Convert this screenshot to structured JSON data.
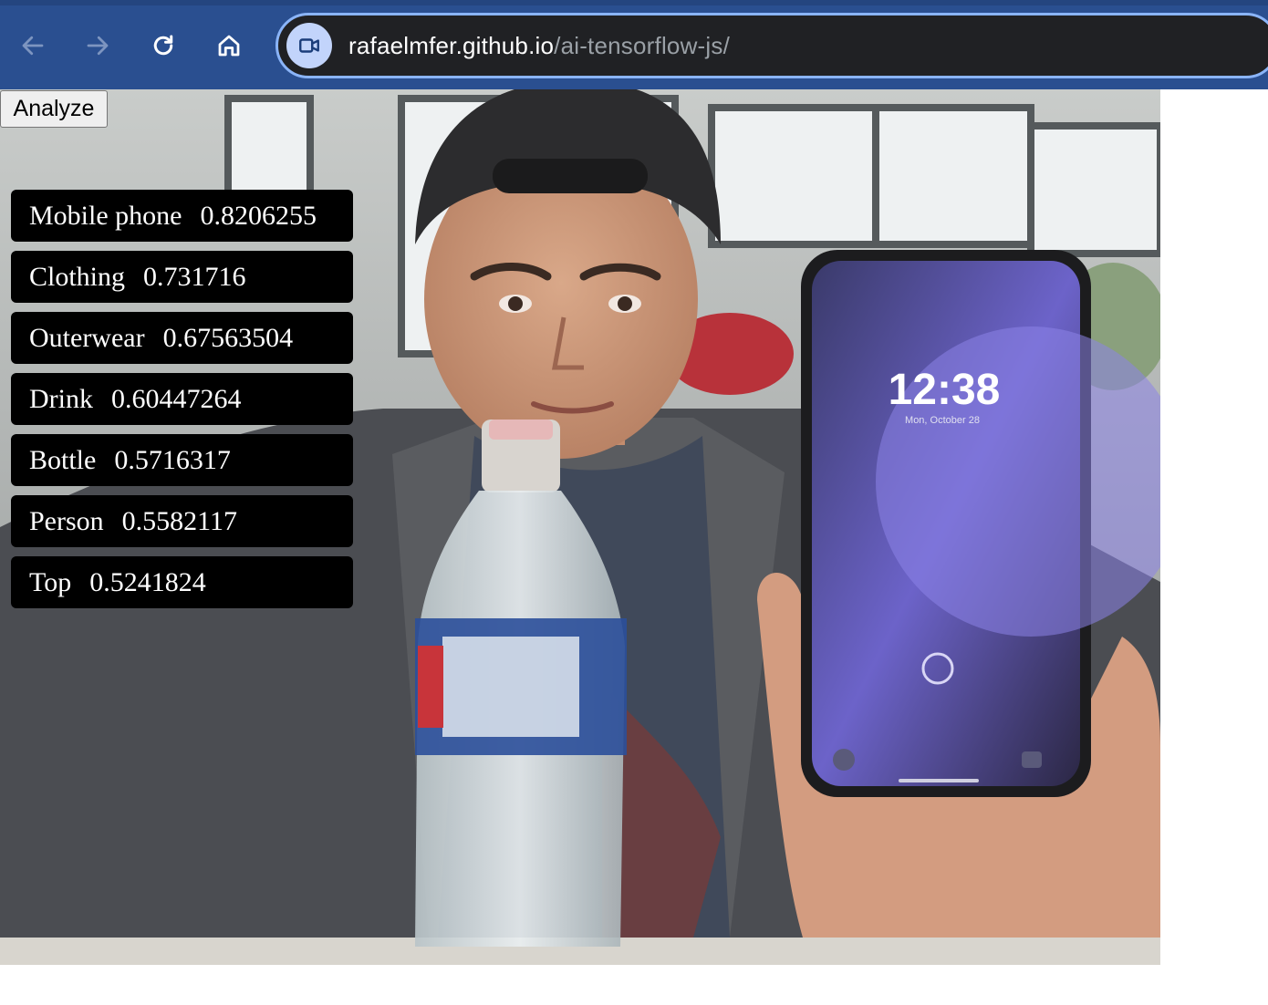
{
  "browser": {
    "nav": {
      "back_icon": "arrow-left-icon",
      "forward_icon": "arrow-right-icon",
      "reload_icon": "reload-icon",
      "home_icon": "home-icon"
    },
    "omnibox": {
      "site_icon": "video-camera-icon",
      "url_host": "rafaelmfer.github.io",
      "url_path": "/ai-tensorflow-js/"
    },
    "colors": {
      "toolbar": "#2a4f90",
      "omnibox_bg": "#202124",
      "omnibox_border": "#8ab4f8",
      "url_path": "#9aa0a6"
    }
  },
  "page": {
    "analyze_label": "Analyze",
    "predictions": [
      {
        "label": "Mobile phone",
        "score": "0.8206255"
      },
      {
        "label": "Clothing",
        "score": "0.731716"
      },
      {
        "label": "Outerwear",
        "score": "0.67563504"
      },
      {
        "label": "Drink",
        "score": "0.60447264"
      },
      {
        "label": "Bottle",
        "score": "0.5716317"
      },
      {
        "label": "Person",
        "score": "0.5582117"
      },
      {
        "label": "Top",
        "score": "0.5241824"
      }
    ],
    "phone_screen": {
      "time": "12:38",
      "date": "Mon, October 28"
    }
  }
}
